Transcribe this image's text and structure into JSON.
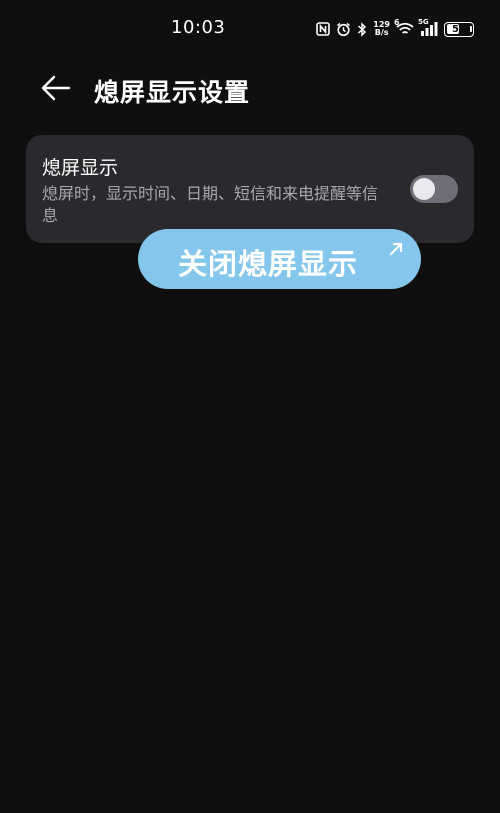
{
  "status_bar": {
    "time": "10:03",
    "icons": [
      "nfc-icon",
      "alarm-icon",
      "bluetooth-icon",
      "wifi-icon",
      "signal-icon",
      "battery-icon"
    ],
    "net_speed_value": "129",
    "net_speed_unit": "B/s",
    "wifi_label": "6",
    "signal_label": "5G",
    "battery_level": "50",
    "battery_fraction": 0.5
  },
  "header": {
    "back_icon": "arrow-left-icon",
    "title": "熄屏显示设置"
  },
  "setting": {
    "title": "熄屏显示",
    "description": "熄屏时，显示时间、日期、短信和来电提醒等信息",
    "toggle_on": false
  },
  "callout": {
    "text": "关闭熄屏显示",
    "icon": "arrow-up-right-icon",
    "color": "#84c6ec"
  },
  "colors": {
    "background": "#0f0f10",
    "card": "#2a2a2e",
    "toggle_off": "#6e6e78"
  }
}
